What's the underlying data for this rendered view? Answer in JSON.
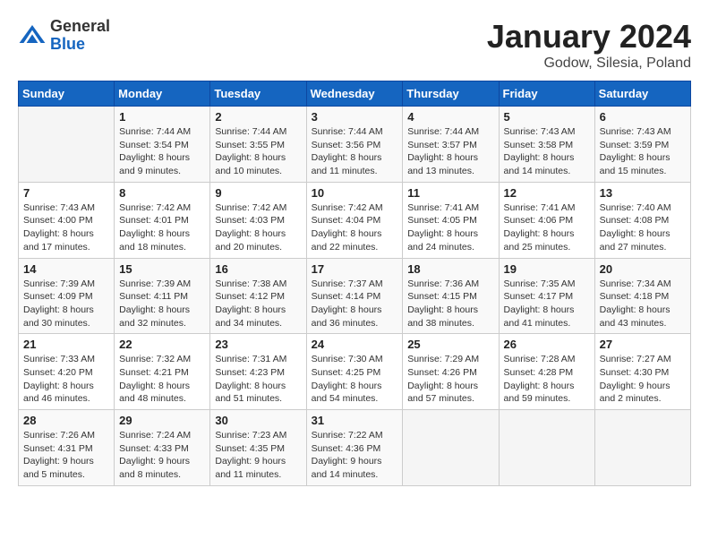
{
  "header": {
    "logo_general": "General",
    "logo_blue": "Blue",
    "month_title": "January 2024",
    "location": "Godow, Silesia, Poland"
  },
  "weekdays": [
    "Sunday",
    "Monday",
    "Tuesday",
    "Wednesday",
    "Thursday",
    "Friday",
    "Saturday"
  ],
  "weeks": [
    [
      {
        "day": "",
        "info": ""
      },
      {
        "day": "1",
        "info": "Sunrise: 7:44 AM\nSunset: 3:54 PM\nDaylight: 8 hours\nand 9 minutes."
      },
      {
        "day": "2",
        "info": "Sunrise: 7:44 AM\nSunset: 3:55 PM\nDaylight: 8 hours\nand 10 minutes."
      },
      {
        "day": "3",
        "info": "Sunrise: 7:44 AM\nSunset: 3:56 PM\nDaylight: 8 hours\nand 11 minutes."
      },
      {
        "day": "4",
        "info": "Sunrise: 7:44 AM\nSunset: 3:57 PM\nDaylight: 8 hours\nand 13 minutes."
      },
      {
        "day": "5",
        "info": "Sunrise: 7:43 AM\nSunset: 3:58 PM\nDaylight: 8 hours\nand 14 minutes."
      },
      {
        "day": "6",
        "info": "Sunrise: 7:43 AM\nSunset: 3:59 PM\nDaylight: 8 hours\nand 15 minutes."
      }
    ],
    [
      {
        "day": "7",
        "info": "Sunrise: 7:43 AM\nSunset: 4:00 PM\nDaylight: 8 hours\nand 17 minutes."
      },
      {
        "day": "8",
        "info": "Sunrise: 7:42 AM\nSunset: 4:01 PM\nDaylight: 8 hours\nand 18 minutes."
      },
      {
        "day": "9",
        "info": "Sunrise: 7:42 AM\nSunset: 4:03 PM\nDaylight: 8 hours\nand 20 minutes."
      },
      {
        "day": "10",
        "info": "Sunrise: 7:42 AM\nSunset: 4:04 PM\nDaylight: 8 hours\nand 22 minutes."
      },
      {
        "day": "11",
        "info": "Sunrise: 7:41 AM\nSunset: 4:05 PM\nDaylight: 8 hours\nand 24 minutes."
      },
      {
        "day": "12",
        "info": "Sunrise: 7:41 AM\nSunset: 4:06 PM\nDaylight: 8 hours\nand 25 minutes."
      },
      {
        "day": "13",
        "info": "Sunrise: 7:40 AM\nSunset: 4:08 PM\nDaylight: 8 hours\nand 27 minutes."
      }
    ],
    [
      {
        "day": "14",
        "info": "Sunrise: 7:39 AM\nSunset: 4:09 PM\nDaylight: 8 hours\nand 30 minutes."
      },
      {
        "day": "15",
        "info": "Sunrise: 7:39 AM\nSunset: 4:11 PM\nDaylight: 8 hours\nand 32 minutes."
      },
      {
        "day": "16",
        "info": "Sunrise: 7:38 AM\nSunset: 4:12 PM\nDaylight: 8 hours\nand 34 minutes."
      },
      {
        "day": "17",
        "info": "Sunrise: 7:37 AM\nSunset: 4:14 PM\nDaylight: 8 hours\nand 36 minutes."
      },
      {
        "day": "18",
        "info": "Sunrise: 7:36 AM\nSunset: 4:15 PM\nDaylight: 8 hours\nand 38 minutes."
      },
      {
        "day": "19",
        "info": "Sunrise: 7:35 AM\nSunset: 4:17 PM\nDaylight: 8 hours\nand 41 minutes."
      },
      {
        "day": "20",
        "info": "Sunrise: 7:34 AM\nSunset: 4:18 PM\nDaylight: 8 hours\nand 43 minutes."
      }
    ],
    [
      {
        "day": "21",
        "info": "Sunrise: 7:33 AM\nSunset: 4:20 PM\nDaylight: 8 hours\nand 46 minutes."
      },
      {
        "day": "22",
        "info": "Sunrise: 7:32 AM\nSunset: 4:21 PM\nDaylight: 8 hours\nand 48 minutes."
      },
      {
        "day": "23",
        "info": "Sunrise: 7:31 AM\nSunset: 4:23 PM\nDaylight: 8 hours\nand 51 minutes."
      },
      {
        "day": "24",
        "info": "Sunrise: 7:30 AM\nSunset: 4:25 PM\nDaylight: 8 hours\nand 54 minutes."
      },
      {
        "day": "25",
        "info": "Sunrise: 7:29 AM\nSunset: 4:26 PM\nDaylight: 8 hours\nand 57 minutes."
      },
      {
        "day": "26",
        "info": "Sunrise: 7:28 AM\nSunset: 4:28 PM\nDaylight: 8 hours\nand 59 minutes."
      },
      {
        "day": "27",
        "info": "Sunrise: 7:27 AM\nSunset: 4:30 PM\nDaylight: 9 hours\nand 2 minutes."
      }
    ],
    [
      {
        "day": "28",
        "info": "Sunrise: 7:26 AM\nSunset: 4:31 PM\nDaylight: 9 hours\nand 5 minutes."
      },
      {
        "day": "29",
        "info": "Sunrise: 7:24 AM\nSunset: 4:33 PM\nDaylight: 9 hours\nand 8 minutes."
      },
      {
        "day": "30",
        "info": "Sunrise: 7:23 AM\nSunset: 4:35 PM\nDaylight: 9 hours\nand 11 minutes."
      },
      {
        "day": "31",
        "info": "Sunrise: 7:22 AM\nSunset: 4:36 PM\nDaylight: 9 hours\nand 14 minutes."
      },
      {
        "day": "",
        "info": ""
      },
      {
        "day": "",
        "info": ""
      },
      {
        "day": "",
        "info": ""
      }
    ]
  ]
}
